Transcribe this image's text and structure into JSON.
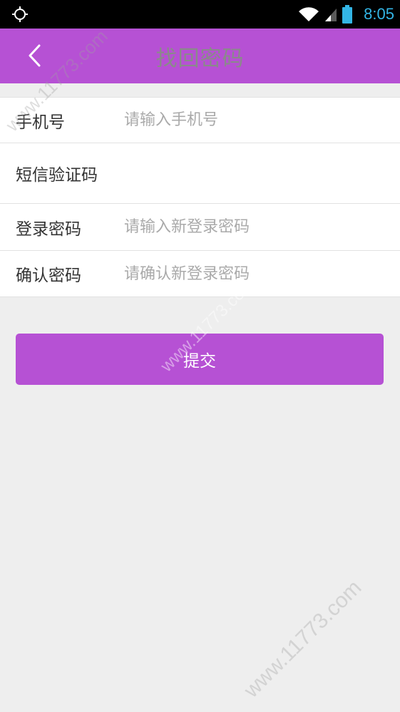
{
  "status_bar": {
    "time": "8:05",
    "left_icon": "location-target-icon",
    "icons": [
      "wifi-icon",
      "signal-icon",
      "battery-icon"
    ]
  },
  "header": {
    "title": "找回密码",
    "back_icon": "chevron-left-icon",
    "background": "#b651d4"
  },
  "form": {
    "rows": [
      {
        "label": "手机号",
        "placeholder": "请输入手机号",
        "value": ""
      },
      {
        "label": "短信验证码",
        "placeholder": "",
        "value": ""
      },
      {
        "label": "登录密码",
        "placeholder": "请输入新登录密码",
        "value": ""
      },
      {
        "label": "确认密码",
        "placeholder": "请确认新登录密码",
        "value": ""
      }
    ]
  },
  "submit": {
    "label": "提交"
  },
  "watermark": {
    "text": "www.11773.com"
  },
  "colors": {
    "accent": "#b651d4",
    "page_bg": "#eeeeee",
    "status_time": "#33b5e5"
  }
}
